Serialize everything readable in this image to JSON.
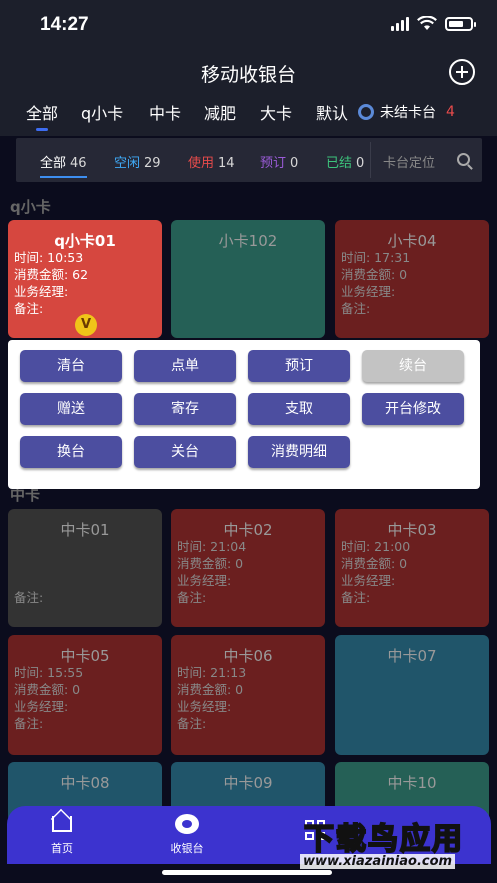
{
  "status_bar": {
    "time": "14:27"
  },
  "header": {
    "title": "移动收银台"
  },
  "categories": [
    "全部",
    "q小卡",
    "中卡",
    "减肥",
    "大卡",
    "默认"
  ],
  "unsettled": {
    "label": "未结卡台",
    "count": "4"
  },
  "filters": [
    {
      "label": "全部",
      "count": "46",
      "color": "#ffffff"
    },
    {
      "label": "空闲",
      "count": "29",
      "color": "#3fa9f5"
    },
    {
      "label": "使用",
      "count": "14",
      "color": "#e84b4b"
    },
    {
      "label": "预订",
      "count": "0",
      "color": "#9b5bd8"
    },
    {
      "label": "已结",
      "count": "0",
      "color": "#3cc47c"
    }
  ],
  "search": {
    "placeholder": "卡台定位"
  },
  "sections": [
    "q小卡",
    "中卡"
  ],
  "tables": [
    {
      "name": "q小卡01",
      "state": "using-active",
      "color": "#d6473f",
      "lines": [
        "时间: 10:53",
        "消费金额: 62",
        "业务经理:",
        "备注:"
      ],
      "badge": "V"
    },
    {
      "name": "小卡102",
      "state": "idle",
      "color": "#256056",
      "lines": []
    },
    {
      "name": "小卡04",
      "state": "using",
      "color": "#6b1f1f",
      "lines": [
        "时间: 17:31",
        "消费金额: 0",
        "业务经理:",
        "备注:"
      ]
    },
    {
      "name": "中卡01",
      "state": "closed",
      "color": "#333333",
      "lines": [
        "",
        "",
        "",
        "备注:"
      ]
    },
    {
      "name": "中卡02",
      "state": "using",
      "color": "#6b1f1f",
      "lines": [
        "时间: 21:04",
        "消费金额: 0",
        "业务经理:",
        "备注:"
      ]
    },
    {
      "name": "中卡03",
      "state": "using",
      "color": "#6b1f1f",
      "lines": [
        "时间: 21:00",
        "消费金额: 0",
        "业务经理:",
        "备注:"
      ]
    },
    {
      "name": "中卡05",
      "state": "using",
      "color": "#6b1f1f",
      "lines": [
        "时间: 15:55",
        "消费金额: 0",
        "业务经理:",
        "备注:"
      ]
    },
    {
      "name": "中卡06",
      "state": "using",
      "color": "#6b1f1f",
      "lines": [
        "时间: 21:13",
        "消费金额: 0",
        "业务经理:",
        "备注:"
      ]
    },
    {
      "name": "中卡07",
      "state": "idle",
      "color": "#20556a",
      "lines": []
    },
    {
      "name": "中卡08",
      "state": "idle",
      "color": "#20556a",
      "lines": []
    },
    {
      "name": "中卡09",
      "state": "idle",
      "color": "#20556a",
      "lines": []
    },
    {
      "name": "中卡10",
      "state": "idle",
      "color": "#256056",
      "lines": []
    }
  ],
  "actions": [
    {
      "label": "清台",
      "enabled": true
    },
    {
      "label": "点单",
      "enabled": true
    },
    {
      "label": "预订",
      "enabled": true
    },
    {
      "label": "续台",
      "enabled": false
    },
    {
      "label": "赠送",
      "enabled": true
    },
    {
      "label": "寄存",
      "enabled": true
    },
    {
      "label": "支取",
      "enabled": true
    },
    {
      "label": "开台修改",
      "enabled": true
    },
    {
      "label": "换台",
      "enabled": true
    },
    {
      "label": "关台",
      "enabled": true
    },
    {
      "label": "消费明细",
      "enabled": true
    }
  ],
  "tabbar": [
    {
      "label": "首页",
      "icon": "home-icon"
    },
    {
      "label": "收银台",
      "icon": "cashier-icon"
    }
  ],
  "watermark": {
    "title": "下载鸟应用",
    "url": "www.xiazainiao.com"
  }
}
